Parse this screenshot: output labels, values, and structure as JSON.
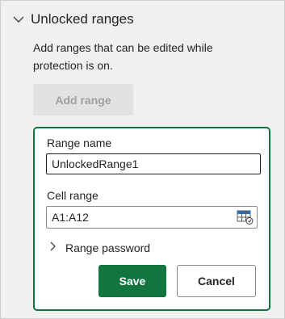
{
  "section": {
    "title": "Unlocked ranges",
    "description": "Add ranges that can be edited while protection is on.",
    "add_range_label": "Add range"
  },
  "form": {
    "range_name_label": "Range name",
    "range_name_value": "UnlockedRange1",
    "cell_range_label": "Cell range",
    "cell_range_value": "A1:A12",
    "cell_range_icon": "select-range-icon",
    "password_toggle_label": "Range password",
    "save_label": "Save",
    "cancel_label": "Cancel"
  },
  "colors": {
    "accent": "#127540",
    "panel_bg": "#f0f0f0",
    "disabled_bg": "#e2e2e2",
    "disabled_text": "#a0a0a0"
  }
}
